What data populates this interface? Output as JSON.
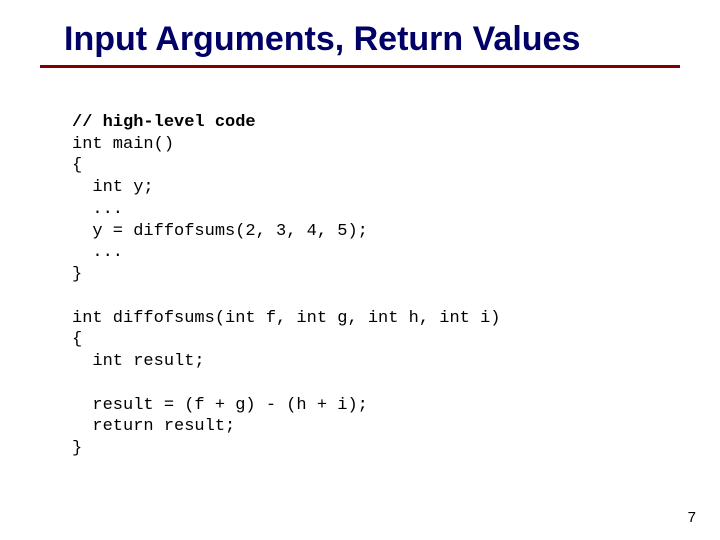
{
  "title": "Input Arguments, Return Values",
  "code": {
    "c0": "// high-level code",
    "c1": "int main()",
    "c2": "{",
    "c3": "  int y;",
    "c4": "  ...",
    "c5": "  y = diffofsums(2, 3, 4, 5);",
    "c6": "  ...",
    "c7": "}",
    "c8": "",
    "c9": "int diffofsums(int f, int g, int h, int i)",
    "c10": "{",
    "c11": "  int result;",
    "c12": "",
    "c13": "  result = (f + g) - (h + i);",
    "c14": "  return result;",
    "c15": "}"
  },
  "page_number": "7"
}
